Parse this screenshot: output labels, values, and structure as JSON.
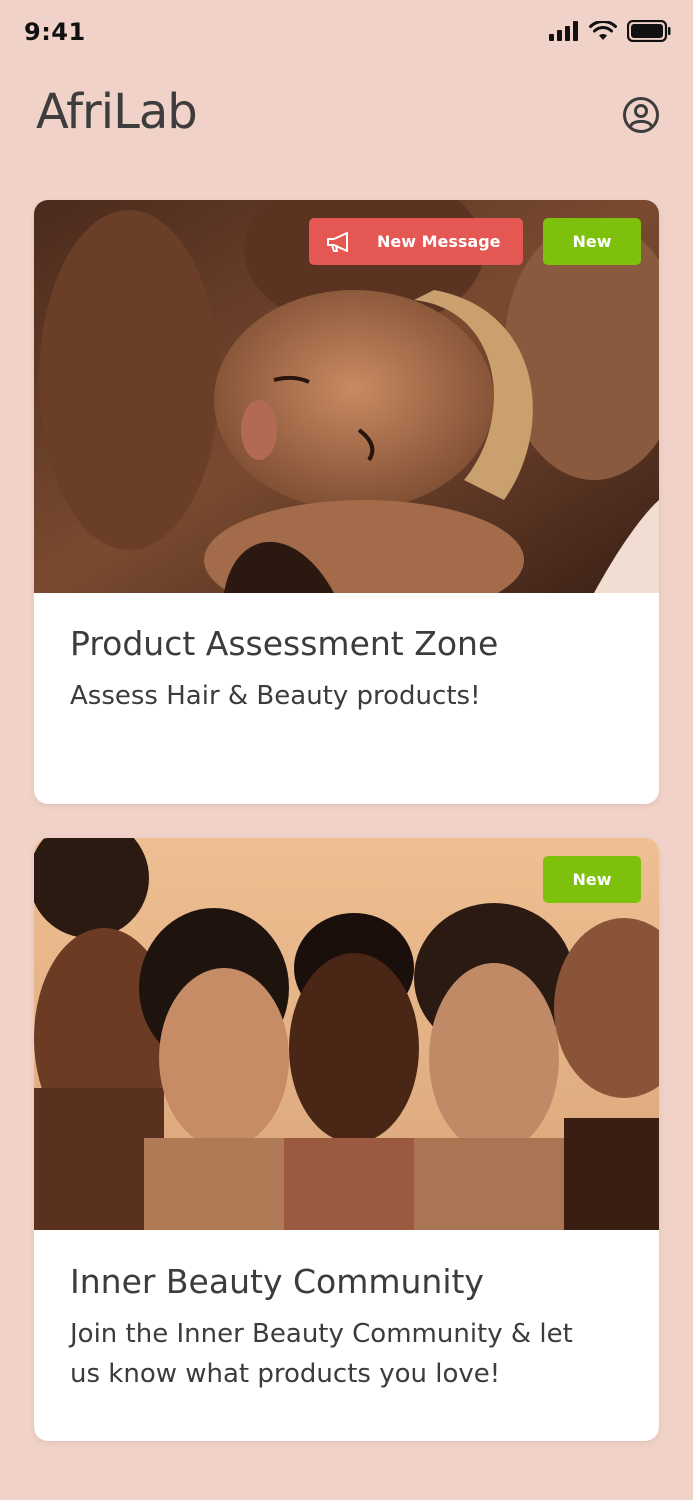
{
  "status": {
    "time": "9:41"
  },
  "header": {
    "brand": "AfriLab"
  },
  "cards": [
    {
      "title": "Product Assessment Zone",
      "subtitle": "Assess Hair & Beauty products!",
      "badge_message": "New Message",
      "badge_new": "New"
    },
    {
      "title": "Inner Beauty Community",
      "subtitle": "Join the Inner Beauty Community & let us know what products you love!",
      "badge_new": "New"
    }
  ],
  "colors": {
    "background": "#f0d2c8",
    "badge_new": "#7dc10d",
    "badge_message": "#e45753"
  },
  "icons": [
    "cellular-signal-icon",
    "wifi-icon",
    "battery-icon",
    "profile-icon",
    "megaphone-icon"
  ]
}
